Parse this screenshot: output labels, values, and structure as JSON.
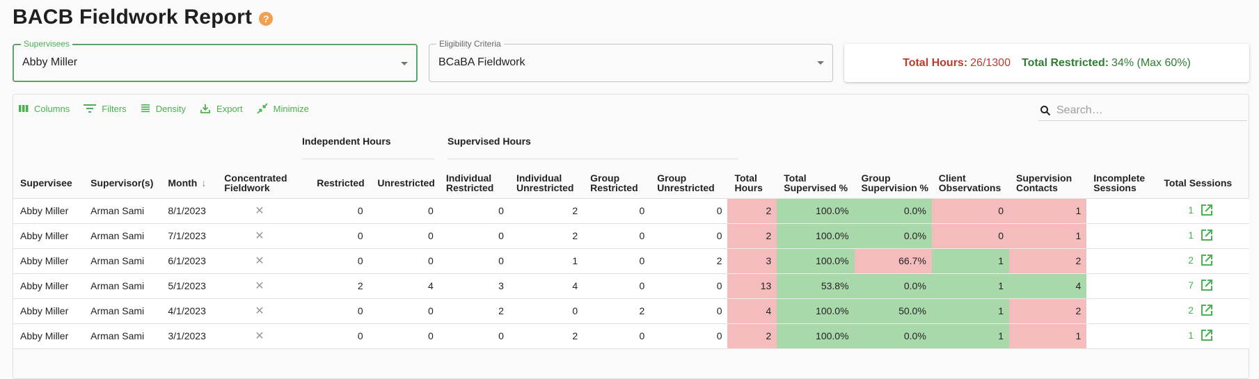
{
  "page": {
    "title": "BACB Fieldwork Report",
    "help_icon": "help-circle-icon"
  },
  "filters": {
    "supervisees": {
      "label": "Supervisees",
      "value": "Abby Miller"
    },
    "eligibility": {
      "label": "Eligibility Criteria",
      "value": "BCaBA Fieldwork"
    }
  },
  "totals": {
    "hours_label": "Total Hours:",
    "hours_value": "26/1300",
    "restricted_label": "Total Restricted:",
    "restricted_value": "34% (Max 60%)",
    "hours_color": "#c0392b",
    "restricted_color": "#2e7d32"
  },
  "toolbar": {
    "columns": "Columns",
    "filters": "Filters",
    "density": "Density",
    "export": "Export",
    "minimize": "Minimize",
    "search_placeholder": "Search…",
    "accent": "#4caf50"
  },
  "table": {
    "groups": {
      "independent": "Independent Hours",
      "supervised": "Supervised Hours"
    },
    "columns": [
      "Supervisee",
      "Supervisor(s)",
      "Month",
      "Concentrated Fieldwork",
      "Restricted",
      "Unrestricted",
      "Individual Restricted",
      "Individual Unrestricted",
      "Group Restricted",
      "Group Unrestricted",
      "Total Hours",
      "Total Supervised %",
      "Group Supervision %",
      "Client Observations",
      "Supervision Contacts",
      "Incomplete Sessions",
      "Total Sessions"
    ],
    "sort": {
      "column": "Month",
      "direction": "descending"
    },
    "status_colors": {
      "red": "#f4bcbc",
      "green": "#a9d9ab"
    },
    "rows": [
      {
        "supervisee": "Abby Miller",
        "supervisor": "Arman Sami",
        "month": "8/1/2023",
        "concentrated": false,
        "ind_restricted": "0",
        "ind_unrestricted": "0",
        "sup_ind_restricted": "0",
        "sup_ind_unrestricted": "2",
        "sup_grp_restricted": "0",
        "sup_grp_unrestricted": "0",
        "total_hours": "2",
        "total_supervised_pct": "100.0%",
        "group_supervision_pct": "0.0%",
        "client_observations": "0",
        "supervision_contacts": "1",
        "incomplete_sessions": "",
        "total_sessions": "1",
        "status": {
          "total_hours": "red",
          "total_supervised_pct": "green",
          "group_supervision_pct": "green",
          "client_observations": "red",
          "supervision_contacts": "red"
        }
      },
      {
        "supervisee": "Abby Miller",
        "supervisor": "Arman Sami",
        "month": "7/1/2023",
        "concentrated": false,
        "ind_restricted": "0",
        "ind_unrestricted": "0",
        "sup_ind_restricted": "0",
        "sup_ind_unrestricted": "2",
        "sup_grp_restricted": "0",
        "sup_grp_unrestricted": "0",
        "total_hours": "2",
        "total_supervised_pct": "100.0%",
        "group_supervision_pct": "0.0%",
        "client_observations": "0",
        "supervision_contacts": "1",
        "incomplete_sessions": "",
        "total_sessions": "1",
        "status": {
          "total_hours": "red",
          "total_supervised_pct": "green",
          "group_supervision_pct": "green",
          "client_observations": "red",
          "supervision_contacts": "red"
        }
      },
      {
        "supervisee": "Abby Miller",
        "supervisor": "Arman Sami",
        "month": "6/1/2023",
        "concentrated": false,
        "ind_restricted": "0",
        "ind_unrestricted": "0",
        "sup_ind_restricted": "0",
        "sup_ind_unrestricted": "1",
        "sup_grp_restricted": "0",
        "sup_grp_unrestricted": "2",
        "total_hours": "3",
        "total_supervised_pct": "100.0%",
        "group_supervision_pct": "66.7%",
        "client_observations": "1",
        "supervision_contacts": "2",
        "incomplete_sessions": "",
        "total_sessions": "2",
        "status": {
          "total_hours": "red",
          "total_supervised_pct": "green",
          "group_supervision_pct": "red",
          "client_observations": "green",
          "supervision_contacts": "red"
        }
      },
      {
        "supervisee": "Abby Miller",
        "supervisor": "Arman Sami",
        "month": "5/1/2023",
        "concentrated": false,
        "ind_restricted": "2",
        "ind_unrestricted": "4",
        "sup_ind_restricted": "3",
        "sup_ind_unrestricted": "4",
        "sup_grp_restricted": "0",
        "sup_grp_unrestricted": "0",
        "total_hours": "13",
        "total_supervised_pct": "53.8%",
        "group_supervision_pct": "0.0%",
        "client_observations": "1",
        "supervision_contacts": "4",
        "incomplete_sessions": "",
        "total_sessions": "7",
        "status": {
          "total_hours": "red",
          "total_supervised_pct": "green",
          "group_supervision_pct": "green",
          "client_observations": "green",
          "supervision_contacts": "green"
        }
      },
      {
        "supervisee": "Abby Miller",
        "supervisor": "Arman Sami",
        "month": "4/1/2023",
        "concentrated": false,
        "ind_restricted": "0",
        "ind_unrestricted": "0",
        "sup_ind_restricted": "2",
        "sup_ind_unrestricted": "0",
        "sup_grp_restricted": "2",
        "sup_grp_unrestricted": "0",
        "total_hours": "4",
        "total_supervised_pct": "100.0%",
        "group_supervision_pct": "50.0%",
        "client_observations": "1",
        "supervision_contacts": "2",
        "incomplete_sessions": "",
        "total_sessions": "2",
        "status": {
          "total_hours": "red",
          "total_supervised_pct": "green",
          "group_supervision_pct": "green",
          "client_observations": "green",
          "supervision_contacts": "red"
        }
      },
      {
        "supervisee": "Abby Miller",
        "supervisor": "Arman Sami",
        "month": "3/1/2023",
        "concentrated": false,
        "ind_restricted": "0",
        "ind_unrestricted": "0",
        "sup_ind_restricted": "0",
        "sup_ind_unrestricted": "2",
        "sup_grp_restricted": "0",
        "sup_grp_unrestricted": "0",
        "total_hours": "2",
        "total_supervised_pct": "100.0%",
        "group_supervision_pct": "0.0%",
        "client_observations": "1",
        "supervision_contacts": "1",
        "incomplete_sessions": "",
        "total_sessions": "1",
        "status": {
          "total_hours": "red",
          "total_supervised_pct": "green",
          "group_supervision_pct": "green",
          "client_observations": "green",
          "supervision_contacts": "red"
        }
      }
    ]
  }
}
